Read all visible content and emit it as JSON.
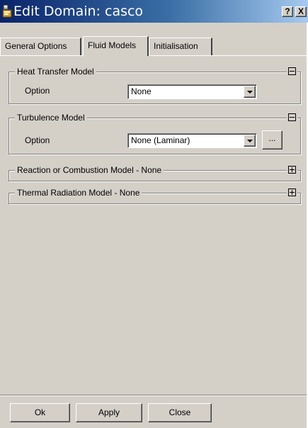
{
  "window": {
    "title": "Edit Domain: casco",
    "help_label": "?",
    "close_label": "X"
  },
  "tabs": [
    {
      "label": "General Options",
      "active": false
    },
    {
      "label": "Fluid Models",
      "active": true
    },
    {
      "label": "Initialisation",
      "active": false
    }
  ],
  "heat_transfer": {
    "title": "Heat Transfer Model",
    "expanded": true,
    "option_label": "Option",
    "option_value": "None"
  },
  "turbulence": {
    "title": "Turbulence Model",
    "expanded": true,
    "option_label": "Option",
    "option_value": "None (Laminar)",
    "more_label": "..."
  },
  "reaction": {
    "title": "Reaction or Combustion Model - None",
    "expanded": false
  },
  "radiation": {
    "title": "Thermal Radiation Model - None",
    "expanded": false
  },
  "buttons": {
    "ok": "Ok",
    "apply": "Apply",
    "close": "Close"
  },
  "icons": {
    "app": "application-icon",
    "collapse": "minus-box-icon",
    "expand": "plus-box-icon",
    "dropdown": "chevron-down-icon"
  },
  "colors": {
    "dialog_bg": "#d4d0c8",
    "titlebar_start": "#0a246a",
    "titlebar_end": "#a6caf0"
  }
}
